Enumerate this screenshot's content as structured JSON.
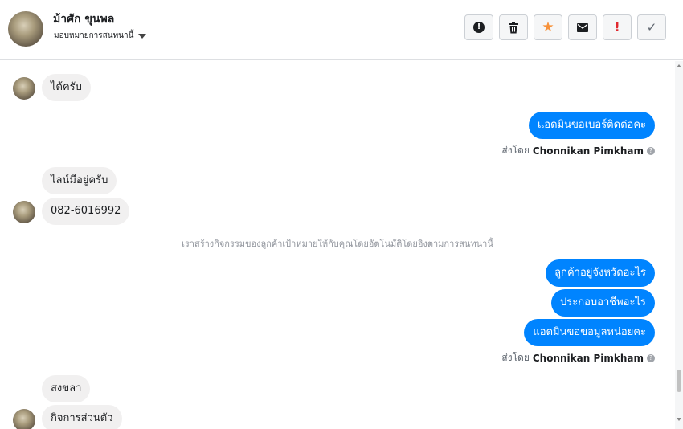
{
  "header": {
    "name": "ม้าศัก ขุนพล",
    "assign_label": "มอบหมายการสนทนานี้",
    "toolbar": [
      {
        "icon": "alert-circle-icon",
        "name": "mark-spam-button",
        "glyph": "!",
        "color": "#1c1e21"
      },
      {
        "icon": "trash-icon",
        "name": "delete-button",
        "glyph": "🗑",
        "color": "#1c1e21"
      },
      {
        "icon": "star-icon",
        "name": "star-button",
        "glyph": "★",
        "color": "#f7923b"
      },
      {
        "icon": "envelope-icon",
        "name": "mark-unread-button",
        "glyph": "✉",
        "color": "#1c1e21"
      },
      {
        "icon": "exclamation-icon",
        "name": "follow-up-button",
        "glyph": "!",
        "color": "#e0282e"
      },
      {
        "icon": "check-icon",
        "name": "mark-done-button",
        "glyph": "✓",
        "color": "#606770"
      }
    ]
  },
  "messages": {
    "m1": "ได้ครับ",
    "m2": "แอดมินขอเบอร์ติดต่อคะ",
    "sent_prefix": "ส่งโดย",
    "sender": "Chonnikan Pimkham",
    "m3": "ไลน์มีอยู่ครับ",
    "m4": "082-6016992",
    "system": "เราสร้างกิจกรรมของลูกค้าเป้าหมายให้กับคุณโดยอัตโนมัติโดยอิงตามการสนทนานี้",
    "m5": "ลูกค้าอยู่จังหวัดอะไร",
    "m6": "ประกอบอาชีพอะไร",
    "m7": "แอดมินขอขอมูลหน่อยคะ",
    "m8": "สงขลา",
    "m9": "กิจการส่วนตัว"
  }
}
